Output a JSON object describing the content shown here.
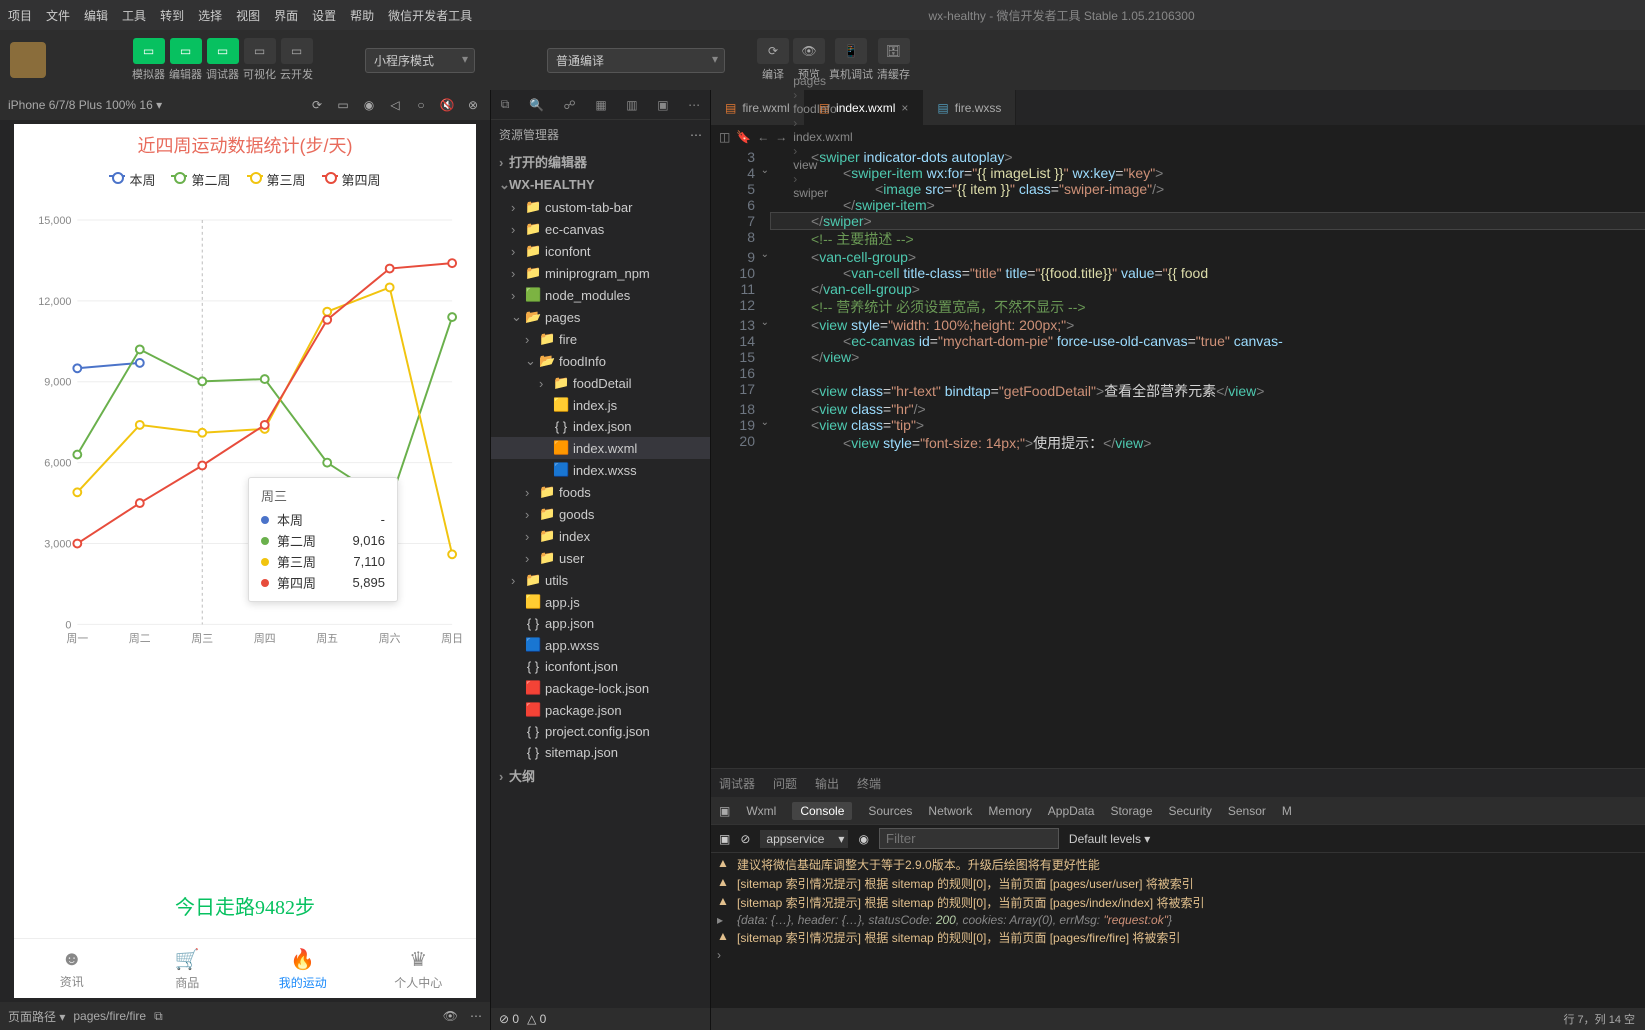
{
  "menu": [
    "项目",
    "文件",
    "编辑",
    "工具",
    "转到",
    "选择",
    "视图",
    "界面",
    "设置",
    "帮助",
    "微信开发者工具"
  ],
  "window_title": "wx-healthy - 微信开发者工具 Stable 1.05.2106300",
  "toolbar": {
    "buttons": [
      {
        "label": "模拟器",
        "green": true
      },
      {
        "label": "编辑器",
        "green": true
      },
      {
        "label": "调试器",
        "green": true
      },
      {
        "label": "可视化",
        "green": false
      },
      {
        "label": "云开发",
        "green": false
      }
    ],
    "mode": "小程序模式",
    "compile": "普通编译",
    "right": [
      "编译",
      "预览",
      "真机调试",
      "清缓存"
    ]
  },
  "sim": {
    "device": "iPhone 6/7/8 Plus 100% 16 ▾",
    "chart_title": "近四周运动数据统计(步/天)",
    "legend": [
      "本周",
      "第二周",
      "第三周",
      "第四周"
    ],
    "y_ticks": [
      "0",
      "3,000",
      "6,000",
      "9,000",
      "12,000",
      "15,000"
    ],
    "x_ticks": [
      "周一",
      "周二",
      "周三",
      "周四",
      "周五",
      "周六",
      "周日"
    ],
    "tooltip": {
      "title": "周三",
      "rows": [
        {
          "name": "本周",
          "val": "-",
          "c": "#4b73c9"
        },
        {
          "name": "第二周",
          "val": "9,016",
          "c": "#6ab04c"
        },
        {
          "name": "第三周",
          "val": "7,110",
          "c": "#f1c40f"
        },
        {
          "name": "第四周",
          "val": "5,895",
          "c": "#e74c3c"
        }
      ]
    },
    "today": "今日走路9482步",
    "tabs": [
      {
        "label": "资讯",
        "icon": "☻"
      },
      {
        "label": "商品",
        "icon": "🛒"
      },
      {
        "label": "我的运动",
        "icon": "🔥",
        "active": true
      },
      {
        "label": "个人中心",
        "icon": "♛"
      }
    ],
    "page_path_label": "页面路径 ▾",
    "page_path": "pages/fire/fire"
  },
  "chart_data": {
    "type": "line",
    "title": "近四周运动数据统计(步/天)",
    "xlabel": "",
    "ylabel": "",
    "categories": [
      "周一",
      "周二",
      "周三",
      "周四",
      "周五",
      "周六",
      "周日"
    ],
    "ylim": [
      0,
      15000
    ],
    "series": [
      {
        "name": "本周",
        "color": "#4b73c9",
        "values": [
          9500,
          9700,
          null,
          null,
          null,
          null,
          null
        ]
      },
      {
        "name": "第二周",
        "color": "#6ab04c",
        "values": [
          6300,
          10200,
          9016,
          9100,
          6000,
          4500,
          11400
        ]
      },
      {
        "name": "第三周",
        "color": "#f1c40f",
        "values": [
          4900,
          7400,
          7110,
          7250,
          11600,
          12500,
          2600
        ]
      },
      {
        "name": "第四周",
        "color": "#e74c3c",
        "values": [
          3000,
          4500,
          5895,
          7400,
          11300,
          13200,
          13400
        ]
      }
    ],
    "tooltip_at": "周三"
  },
  "explorer": {
    "title": "资源管理器",
    "sections": {
      "editors": "打开的编辑器",
      "outline": "大纲"
    },
    "project": "WX-HEALTHY",
    "tree": [
      {
        "d": 1,
        "t": "folder",
        "l": "custom-tab-bar"
      },
      {
        "d": 1,
        "t": "folder",
        "l": "ec-canvas"
      },
      {
        "d": 1,
        "t": "folder",
        "l": "iconfont"
      },
      {
        "d": 1,
        "t": "folder",
        "l": "miniprogram_npm"
      },
      {
        "d": 1,
        "t": "folder-g",
        "l": "node_modules"
      },
      {
        "d": 1,
        "t": "folder-o",
        "l": "pages",
        "open": true
      },
      {
        "d": 2,
        "t": "folder",
        "l": "fire"
      },
      {
        "d": 2,
        "t": "folder-o",
        "l": "foodInfo",
        "open": true
      },
      {
        "d": 3,
        "t": "folder",
        "l": "foodDetail"
      },
      {
        "d": 3,
        "t": "js",
        "l": "index.js"
      },
      {
        "d": 3,
        "t": "json",
        "l": "index.json"
      },
      {
        "d": 3,
        "t": "wxml",
        "l": "index.wxml",
        "active": true
      },
      {
        "d": 3,
        "t": "wxss",
        "l": "index.wxss"
      },
      {
        "d": 2,
        "t": "folder",
        "l": "foods"
      },
      {
        "d": 2,
        "t": "folder",
        "l": "goods"
      },
      {
        "d": 2,
        "t": "folder",
        "l": "index"
      },
      {
        "d": 2,
        "t": "folder",
        "l": "user"
      },
      {
        "d": 1,
        "t": "folder",
        "l": "utils"
      },
      {
        "d": 1,
        "t": "js",
        "l": "app.js"
      },
      {
        "d": 1,
        "t": "json",
        "l": "app.json"
      },
      {
        "d": 1,
        "t": "wxss",
        "l": "app.wxss"
      },
      {
        "d": 1,
        "t": "json",
        "l": "iconfont.json"
      },
      {
        "d": 1,
        "t": "npm",
        "l": "package-lock.json"
      },
      {
        "d": 1,
        "t": "npm",
        "l": "package.json"
      },
      {
        "d": 1,
        "t": "json",
        "l": "project.config.json"
      },
      {
        "d": 1,
        "t": "json",
        "l": "sitemap.json"
      }
    ]
  },
  "editor": {
    "tabs": [
      {
        "label": "fire.wxml",
        "icon": "wxml"
      },
      {
        "label": "index.wxml",
        "icon": "wxml",
        "active": true,
        "close": true
      },
      {
        "label": "fire.wxss",
        "icon": "wxss"
      }
    ],
    "breadcrumb": [
      "pages",
      "foodInfo",
      "index.wxml",
      "view",
      "swiper"
    ],
    "lines": [
      {
        "n": 3,
        "h": "<span class='t-brkt'>&lt;</span><span class='t-tag'>swiper</span> <span class='t-attr'>indicator-dots</span> <span class='t-attr'>autoplay</span><span class='t-brkt'>&gt;</span>",
        "ind": 1
      },
      {
        "n": 4,
        "h": "<span class='t-brkt'>&lt;</span><span class='t-tag'>swiper-item</span> <span class='t-attr'>wx:for</span>=<span class='t-str'>\"</span><span class='t-exp'>{{ imageList }}</span><span class='t-str'>\"</span> <span class='t-attr'>wx:key</span>=<span class='t-str'>\"key\"</span><span class='t-brkt'>&gt;</span>",
        "ind": 2
      },
      {
        "n": 5,
        "h": "<span class='t-brkt'>&lt;</span><span class='t-tag'>image</span> <span class='t-attr'>src</span>=<span class='t-str'>\"</span><span class='t-exp'>{{ item }}</span><span class='t-str'>\"</span> <span class='t-attr'>class</span>=<span class='t-str'>\"swiper-image\"</span><span class='t-brkt'>/&gt;</span>",
        "ind": 3
      },
      {
        "n": 6,
        "h": "<span class='t-brkt'>&lt;/</span><span class='t-tag'>swiper-item</span><span class='t-brkt'>&gt;</span>",
        "ind": 2
      },
      {
        "n": 7,
        "h": "<span class='t-brkt'>&lt;/</span><span class='t-tag'>swiper</span><span class='t-brkt'>&gt;</span>",
        "ind": 1,
        "cur": true
      },
      {
        "n": 8,
        "h": "<span class='t-cmt'>&lt;!-- 主要描述 --&gt;</span>",
        "ind": 1
      },
      {
        "n": 9,
        "h": "<span class='t-brkt'>&lt;</span><span class='t-tag'>van-cell-group</span><span class='t-brkt'>&gt;</span>",
        "ind": 1
      },
      {
        "n": 10,
        "h": "<span class='t-brkt'>&lt;</span><span class='t-tag'>van-cell</span> <span class='t-attr'>title-class</span>=<span class='t-str'>\"title\"</span> <span class='t-attr'>title</span>=<span class='t-str'>\"</span><span class='t-exp'>{{food.title}}</span><span class='t-str'>\"</span> <span class='t-attr'>value</span>=<span class='t-str'>\"</span><span class='t-exp'>{{ food</span>",
        "ind": 2
      },
      {
        "n": 11,
        "h": "<span class='t-brkt'>&lt;/</span><span class='t-tag'>van-cell-group</span><span class='t-brkt'>&gt;</span>",
        "ind": 1
      },
      {
        "n": 12,
        "h": "<span class='t-cmt'>&lt;!-- 营养统计 必须设置宽高，不然不显示 --&gt;</span>",
        "ind": 1
      },
      {
        "n": 13,
        "h": "<span class='t-brkt'>&lt;</span><span class='t-tag'>view</span> <span class='t-attr'>style</span>=<span class='t-str'>\"width: 100%;height: 200px;\"</span><span class='t-brkt'>&gt;</span>",
        "ind": 1
      },
      {
        "n": 14,
        "h": "<span class='t-brkt'>&lt;</span><span class='t-tag'>ec-canvas</span> <span class='t-attr'>id</span>=<span class='t-str'>\"mychart-dom-pie\"</span> <span class='t-attr'>force-use-old-canvas</span>=<span class='t-str'>\"true\"</span> <span class='t-attr'>canvas-</span>",
        "ind": 2
      },
      {
        "n": 15,
        "h": "<span class='t-brkt'>&lt;/</span><span class='t-tag'>view</span><span class='t-brkt'>&gt;</span>",
        "ind": 1
      },
      {
        "n": 16,
        "h": "",
        "ind": 1
      },
      {
        "n": 17,
        "h": "<span class='t-brkt'>&lt;</span><span class='t-tag'>view</span> <span class='t-attr'>class</span>=<span class='t-str'>\"hr-text\"</span> <span class='t-attr'>bindtap</span>=<span class='t-str'>\"getFoodDetail\"</span><span class='t-brkt'>&gt;</span><span class='t-txt'>查看全部营养元素</span><span class='t-brkt'>&lt;/</span><span class='t-tag'>view</span><span class='t-brkt'>&gt;</span>",
        "ind": 1
      },
      {
        "n": 18,
        "h": "<span class='t-brkt'>&lt;</span><span class='t-tag'>view</span> <span class='t-attr'>class</span>=<span class='t-str'>\"hr\"</span><span class='t-brkt'>/&gt;</span>",
        "ind": 1
      },
      {
        "n": 19,
        "h": "<span class='t-brkt'>&lt;</span><span class='t-tag'>view</span> <span class='t-attr'>class</span>=<span class='t-str'>\"tip\"</span><span class='t-brkt'>&gt;</span>",
        "ind": 1
      },
      {
        "n": 20,
        "h": "<span class='t-brkt'>&lt;</span><span class='t-tag'>view</span> <span class='t-attr'>style</span>=<span class='t-str'>\"font-size: 14px;\"</span><span class='t-brkt'>&gt;</span><span class='t-txt'>使用提示：</span><span class='t-brkt'>&lt;/</span><span class='t-tag'>view</span><span class='t-brkt'>&gt;</span>",
        "ind": 2
      }
    ]
  },
  "debugger": {
    "tabs": [
      "调试器",
      "问题",
      "输出",
      "终端"
    ],
    "sub": [
      "Wxml",
      "Console",
      "Sources",
      "Network",
      "Memory",
      "AppData",
      "Storage",
      "Security",
      "Sensor",
      "M"
    ],
    "sub_active": "Console",
    "context": "appservice",
    "filter_ph": "Filter",
    "levels": "Default levels ▾",
    "lines": [
      {
        "t": "warn",
        "txt": "建议将微信基础库调整大于等于2.9.0版本。升级后绘图将有更好性能"
      },
      {
        "t": "warn",
        "txt": "[sitemap 索引情况提示] 根据 sitemap 的规则[0]，当前页面 [pages/user/user] 将被索引"
      },
      {
        "t": "warn",
        "txt": "[sitemap 索引情况提示] 根据 sitemap 的规则[0]，当前页面 [pages/index/index] 将被索引"
      },
      {
        "t": "log",
        "txt": "{data: {…}, header: {…}, statusCode: 200, cookies: Array(0), errMsg: \"request:ok\"}",
        "italic": true
      },
      {
        "t": "warn",
        "txt": "[sitemap 索引情况提示] 根据 sitemap 的规则[0]，当前页面 [pages/fire/fire] 将被索引"
      }
    ]
  },
  "status": {
    "errors": "⊘ 0",
    "warnings": "△ 0",
    "pos": "行 7，列 14   空"
  }
}
